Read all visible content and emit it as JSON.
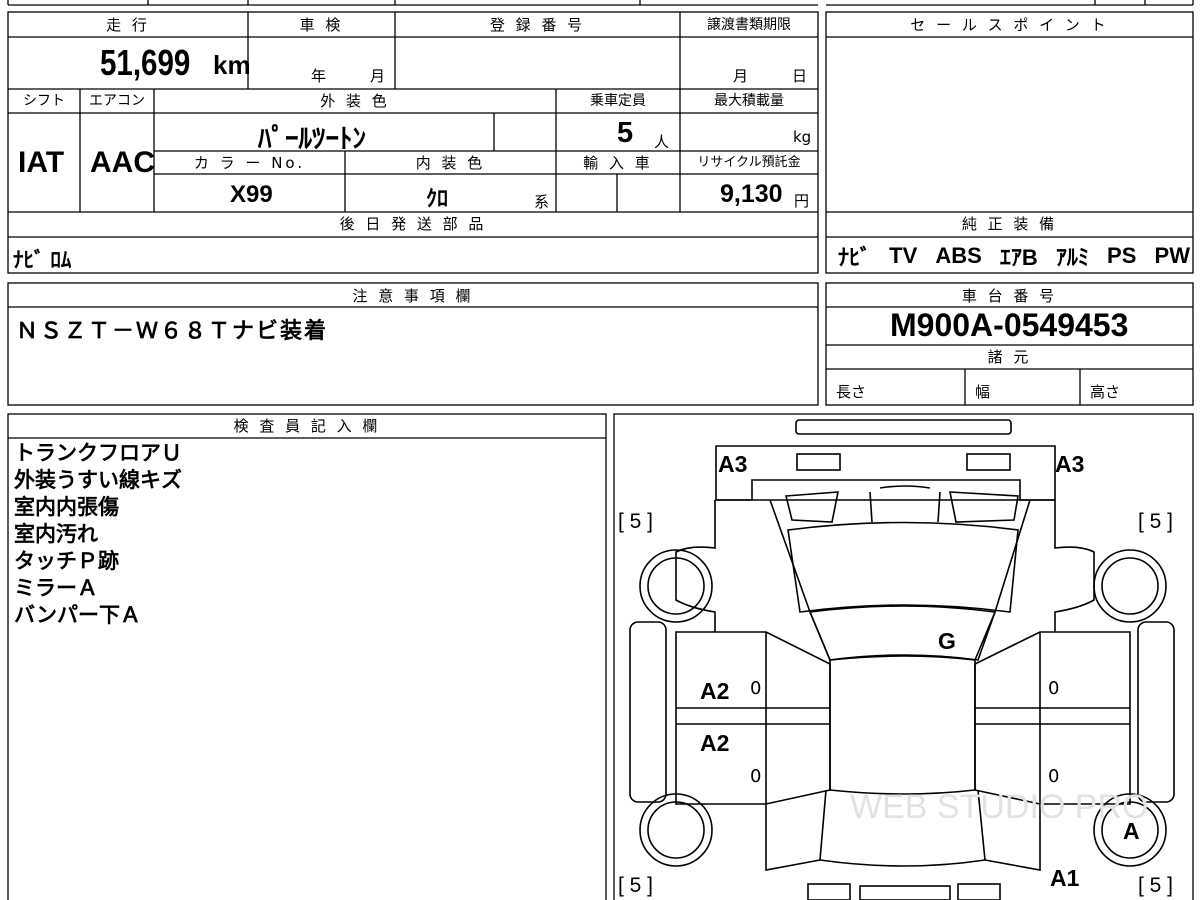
{
  "vehicle": {
    "mileage_header": "走 行",
    "mileage_value": "51,699",
    "mileage_unit": "km",
    "shaken_header": "車 検",
    "shaken_year": "年",
    "shaken_month": "月",
    "registration_header": "登 録 番 号",
    "transfer_deadline_header": "譲渡書類期限",
    "transfer_month": "月",
    "transfer_day": "日",
    "shift_header": "シフト",
    "shift_value": "IAT",
    "aircon_header": "エアコン",
    "aircon_value": "AAC",
    "exterior_color_header": "外 装 色",
    "exterior_color_value": "ﾊﾟｰﾙﾂｰﾄﾝ",
    "capacity_header": "乗車定員",
    "capacity_value": "5",
    "capacity_unit": "人",
    "max_load_header": "最大積載量",
    "max_load_unit": "kg",
    "color_no_header": "カ ラ ー No.",
    "color_no_value": "X99",
    "interior_color_header": "内 装 色",
    "interior_color_value": "ｸﾛ",
    "interior_color_suffix": "系",
    "import_header": "輸 入 車",
    "recycle_header": "リサイクル預託金",
    "recycle_value": "9,130",
    "recycle_unit": "円",
    "later_parts_header": "後 日 発 送 部 品",
    "later_parts_value": "ﾅﾋﾞ ﾛﾑ"
  },
  "sales_point": {
    "header": "セ ー ル ス ポ イ ン ト"
  },
  "genuine_equipment": {
    "header": "純 正 装 備",
    "items": [
      "ﾅﾋﾞ",
      "TV",
      "ABS",
      "ｴｱB",
      "ｱﾙﾐ",
      "PS",
      "PW"
    ]
  },
  "notes": {
    "header": "注 意 事 項 欄",
    "text": "ＮＳＺＴ－Ｗ６８Ｔナビ装着"
  },
  "chassis": {
    "header": "車 台 番 号",
    "value": "M900A-0549453"
  },
  "specs": {
    "header": "諸 元",
    "length_label": "長さ",
    "width_label": "幅",
    "height_label": "高さ"
  },
  "inspector": {
    "header": "検 査 員 記 入 欄",
    "lines": [
      "トランクフロアＵ",
      "外装うすい線キズ",
      "室内内張傷",
      "室内汚れ",
      "タッチＰ跡",
      "ミラーＡ",
      "バンパー下Ａ"
    ]
  },
  "diagram": {
    "marks": {
      "front_left": "A3",
      "front_right": "A3",
      "windshield": "G",
      "front_door_left": "A2",
      "rear_door_left": "A2",
      "rear_wheel_right": "A",
      "rear_quarter_right": "A1",
      "door_zero_1": "0",
      "door_zero_2": "0",
      "door_zero_3": "0",
      "door_zero_4": "0"
    },
    "tires": {
      "front_left": "[ 5 ]",
      "front_right": "[ 5 ]",
      "rear_left": "[ 5 ]",
      "rear_right": "[ 5 ]"
    },
    "watermark": "WEB STUDIO PRO"
  }
}
